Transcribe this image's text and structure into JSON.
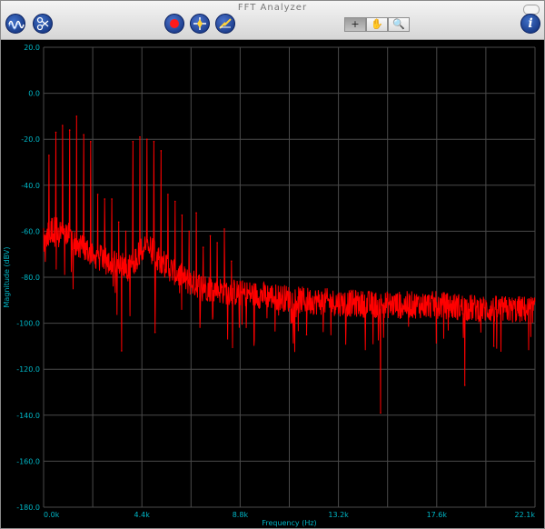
{
  "window": {
    "title": "FFT Analyzer"
  },
  "toolbar": {
    "tools": [
      {
        "name": "crosshair-tool",
        "glyph": "+"
      },
      {
        "name": "hand-tool",
        "glyph": "✋"
      },
      {
        "name": "zoom-tool",
        "glyph": "🔍"
      }
    ],
    "info_glyph": "i",
    "icons": [
      "waveform-icon",
      "oscilloscope-icon",
      "record-icon",
      "capture-icon",
      "auto-icon",
      "info-icon"
    ]
  },
  "chart_data": {
    "type": "line",
    "xlabel": "Frequency (Hz)",
    "ylabel": "Magnitude (dBV)",
    "x_ticks": [
      "0.0k",
      "4.4k",
      "8.8k",
      "13.2k",
      "17.6k",
      "22.1k"
    ],
    "y_ticks": [
      "20.0",
      "0.0",
      "-20.0",
      "-40.0",
      "-60.0",
      "-80.0",
      "-100.0",
      "-120.0",
      "-140.0",
      "-160.0",
      "-180.0"
    ],
    "xlim": [
      0,
      22050
    ],
    "ylim": [
      -180,
      20
    ],
    "grid": true,
    "series": [
      {
        "color": "#ff0000",
        "noise_floor": {
          "x": [
            0,
            300,
            900,
            1500,
            2200,
            3000,
            3800,
            4600,
            5500,
            6500,
            7500,
            8800,
            10000,
            11500,
            13200,
            15000,
            17600,
            20000,
            22050
          ],
          "y": [
            -64,
            -59,
            -60,
            -66,
            -70,
            -74,
            -76,
            -66,
            -75,
            -82,
            -85,
            -87,
            -88,
            -90,
            -91,
            -92,
            -92,
            -94,
            -94
          ]
        },
        "spikes": {
          "x": [
            240,
            550,
            850,
            1170,
            1480,
            1800,
            2110,
            2430,
            2740,
            3060,
            3370,
            3690,
            4010,
            4320,
            4640,
            4950,
            5270,
            5580,
            5900,
            6210,
            6530,
            6850,
            7160,
            7480,
            7790,
            8110,
            8430
          ],
          "y": [
            -27,
            -17,
            -14,
            -16,
            -10,
            -18,
            -21,
            -44,
            -46,
            -46,
            -56,
            -60,
            -21,
            -19,
            -20,
            -21,
            -25,
            -44,
            -47,
            -53,
            -60,
            -52,
            -67,
            -62,
            -65,
            -59,
            -73
          ]
        },
        "dips": {
          "x": [
            3500,
            5000,
            11800,
            15120,
            18900,
            20200
          ],
          "y": [
            -112,
            -104,
            -105,
            -139,
            -127,
            -110
          ]
        }
      }
    ]
  }
}
